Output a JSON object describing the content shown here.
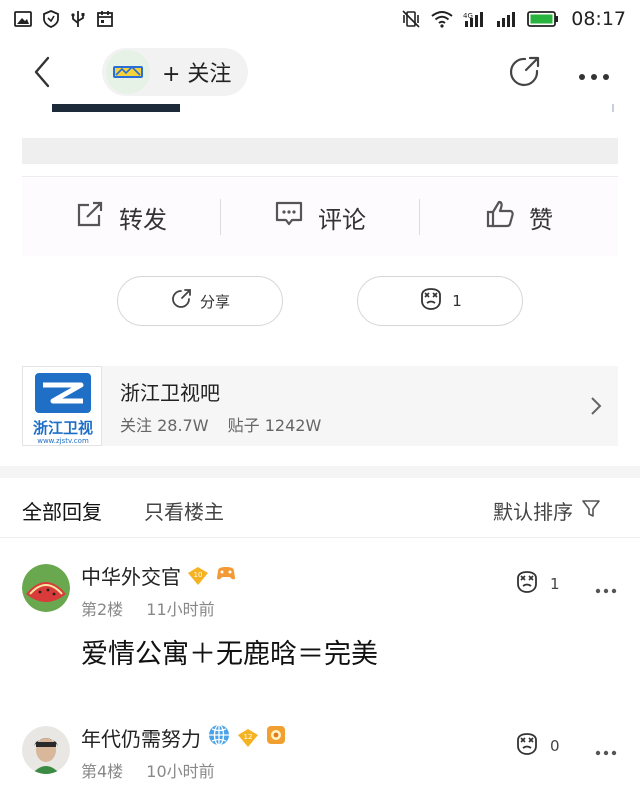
{
  "status_bar": {
    "time": "08:17",
    "left_icons": [
      "image-icon",
      "shield-icon",
      "usb-icon",
      "calendar-icon"
    ],
    "right_icons": [
      "vibrate-icon",
      "wifi-icon",
      "signal-icon",
      "signal-icon",
      "battery-icon"
    ]
  },
  "nav": {
    "follow_label": "+ 关注",
    "icons": [
      "back-icon",
      "share-icon",
      "more-icon"
    ]
  },
  "actions": {
    "repost_label": "转发",
    "comment_label": "评论",
    "like_label": "赞"
  },
  "pills": {
    "share_label": "分享",
    "like_count": "1"
  },
  "forum": {
    "name": "浙江卫视吧",
    "logo_text": "浙江卫视",
    "logo_url_text": "www.zjstv.com",
    "followers_label": "关注 28.7W",
    "posts_label": "贴子 1242W"
  },
  "tabs": {
    "all_replies": "全部回复",
    "only_op": "只看楼主",
    "sort_label": "默认排序"
  },
  "replies": [
    {
      "username": "中华外交官",
      "level": "10",
      "floor": "第2楼",
      "time": "11小时前",
      "like_count": "1",
      "content": "爱情公寓＋无鹿晗＝完美"
    },
    {
      "username": "年代仍需努力",
      "level": "12",
      "floor": "第4楼",
      "time": "10小时前",
      "like_count": "0",
      "content": ""
    }
  ],
  "colors": {
    "forum_blue": "#1f6fc6",
    "badge_gold": "#f5b324",
    "text_primary": "#222222",
    "text_meta": "#888888"
  }
}
